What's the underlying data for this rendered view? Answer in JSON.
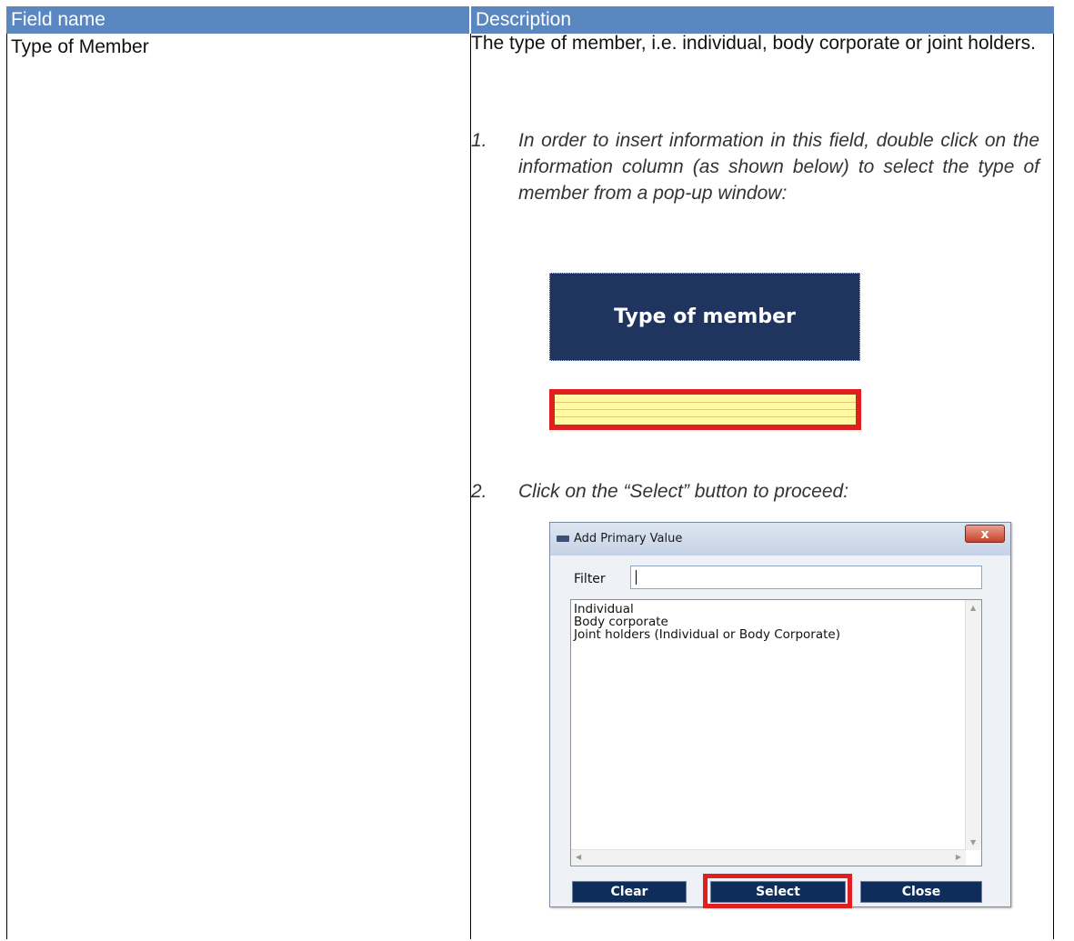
{
  "table": {
    "headers": {
      "field": "Field name",
      "description": "Description"
    },
    "row": {
      "field_name": "Type of Member",
      "description": "The type of member, i.e. individual, body corporate or joint holders.",
      "steps": [
        {
          "num": "1.",
          "text": "In order to insert information in this field, double click on the information column (as shown below) to select the type of member from a pop-up window:"
        },
        {
          "num": "2.",
          "text": "Click on the “Select” button to proceed:"
        }
      ]
    }
  },
  "column_header_image": {
    "label": "Type of member"
  },
  "dialog": {
    "title": "Add Primary Value",
    "close_glyph": "x",
    "filter_label": "Filter",
    "filter_value": "",
    "list_items": [
      "Individual",
      "Body corporate",
      "Joint holders (Individual or Body Corporate)"
    ],
    "buttons": {
      "clear": "Clear",
      "select": "Select",
      "close": "Close"
    }
  },
  "colors": {
    "header_bg": "#5B87C0",
    "highlight": "#E02020",
    "button": "#0E2D5B",
    "cell_yellow": "#FFF9A5"
  }
}
